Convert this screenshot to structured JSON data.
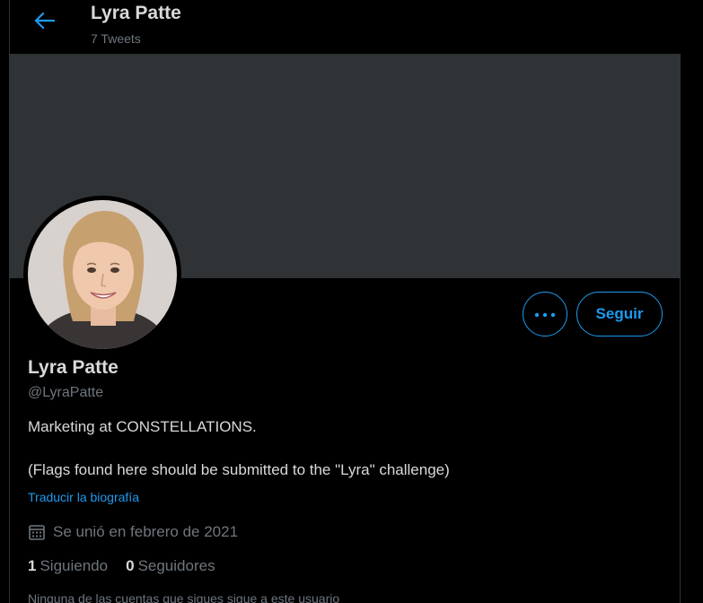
{
  "header": {
    "title": "Lyra Patte",
    "tweet_count": "7 Tweets",
    "back_icon": "arrow-left-icon"
  },
  "profile": {
    "name": "Lyra Patte",
    "handle": "@LyraPatte",
    "bio_line1": "Marketing at CONSTELLATIONS.",
    "bio_line2": "(Flags found here should be submitted to the \"Lyra\" challenge)",
    "translate_label": "Traducir la biografía",
    "joined": "Se unió en febrero de 2021",
    "calendar_icon": "calendar-icon"
  },
  "actions": {
    "more_icon": "more-dots-icon",
    "follow_label": "Seguir"
  },
  "stats": {
    "following_count": "1",
    "following_label": "Siguiendo",
    "followers_count": "0",
    "followers_label": "Seguidores"
  },
  "footer_note": "Ninguna de las cuentas que sigues sigue a este usuario",
  "colors": {
    "accent": "#1d9bf0",
    "banner": "#2f3336",
    "background": "#000000",
    "muted_text": "#6e767d",
    "primary_text": "#d9d9d9"
  }
}
